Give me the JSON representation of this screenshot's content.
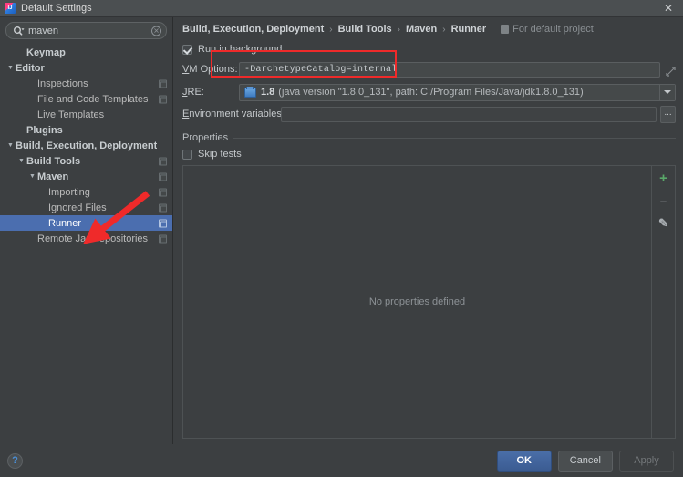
{
  "window": {
    "title": "Default Settings",
    "app_icon": "intellij-idea-icon",
    "close_label": "✕"
  },
  "search": {
    "value": "maven",
    "placeholder": "",
    "icon": "search-icon",
    "clear_label": "✕"
  },
  "sidebar": {
    "items": [
      {
        "label": "Keymap",
        "depth": 1,
        "twisty": "",
        "bold": true,
        "selected": false,
        "badge": false
      },
      {
        "label": "Editor",
        "depth": 0,
        "twisty": "▼",
        "bold": true,
        "selected": false,
        "badge": false
      },
      {
        "label": "Inspections",
        "depth": 2,
        "twisty": "",
        "bold": false,
        "selected": false,
        "badge": true
      },
      {
        "label": "File and Code Templates",
        "depth": 2,
        "twisty": "",
        "bold": false,
        "selected": false,
        "badge": true
      },
      {
        "label": "Live Templates",
        "depth": 2,
        "twisty": "",
        "bold": false,
        "selected": false,
        "badge": false
      },
      {
        "label": "Plugins",
        "depth": 1,
        "twisty": "",
        "bold": true,
        "selected": false,
        "badge": false
      },
      {
        "label": "Build, Execution, Deployment",
        "depth": 0,
        "twisty": "▼",
        "bold": true,
        "selected": false,
        "badge": false
      },
      {
        "label": "Build Tools",
        "depth": 1,
        "twisty": "▼",
        "bold": true,
        "selected": false,
        "badge": true
      },
      {
        "label": "Maven",
        "depth": 2,
        "twisty": "▼",
        "bold": true,
        "selected": false,
        "badge": true
      },
      {
        "label": "Importing",
        "depth": 3,
        "twisty": "",
        "bold": false,
        "selected": false,
        "badge": true
      },
      {
        "label": "Ignored Files",
        "depth": 3,
        "twisty": "",
        "bold": false,
        "selected": false,
        "badge": true
      },
      {
        "label": "Runner",
        "depth": 3,
        "twisty": "",
        "bold": false,
        "selected": true,
        "badge": true
      },
      {
        "label": "Remote Jar Repositories",
        "depth": 2,
        "twisty": "",
        "bold": false,
        "selected": false,
        "badge": true
      }
    ]
  },
  "breadcrumb": {
    "crumbs": [
      "Build, Execution, Deployment",
      "Build Tools",
      "Maven",
      "Runner"
    ],
    "separator": "›",
    "scope_label": "For default project"
  },
  "settings": {
    "run_in_background": {
      "label": "Run in background",
      "checked": true
    },
    "vm_options": {
      "label": "VM Options:",
      "mnemonic": "V",
      "value": "-DarchetypeCatalog=internal",
      "expand_icon": "expand-icon",
      "highlighted": true
    },
    "jre": {
      "label": "JRE:",
      "mnemonic": "J",
      "version": "1.8",
      "description": "(java version \"1.8.0_131\", path: C:/Program Files/Java/jdk1.8.0_131)",
      "icon": "jdk-icon"
    },
    "environment_variables": {
      "label": "Environment variables:",
      "mnemonic": "E",
      "value": "",
      "browse_label": "..."
    },
    "properties": {
      "group_title": "Properties",
      "skip_tests": {
        "label": "Skip tests",
        "checked": false,
        "mnemonic": "t"
      },
      "empty_text": "No properties defined",
      "toolbar": [
        {
          "name": "add-property-button",
          "glyph": "+",
          "color": "#59a869"
        },
        {
          "name": "remove-property-button",
          "glyph": "–",
          "color": "#8d9296"
        },
        {
          "name": "edit-property-button",
          "glyph": "✎",
          "color": "#a9aeb2"
        }
      ]
    }
  },
  "footer": {
    "help_label": "?",
    "ok_label": "OK",
    "cancel_label": "Cancel",
    "apply_label": "Apply"
  },
  "annotation": {
    "arrow_color": "#ef2a2a",
    "box_color": "#ef2a2a"
  },
  "colors": {
    "background": "#3c3f41",
    "selection": "#4b6eaf",
    "accent_green": "#59a869",
    "annotation_red": "#ef2a2a"
  }
}
